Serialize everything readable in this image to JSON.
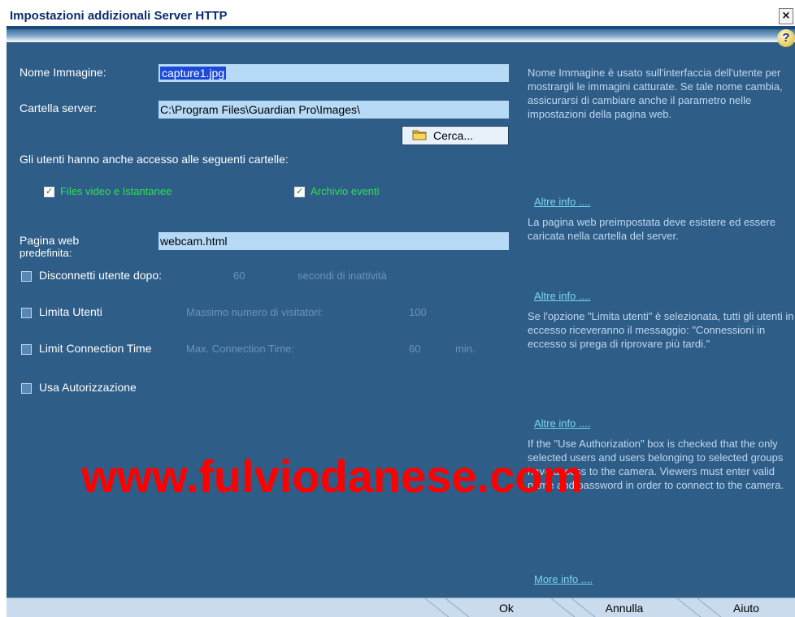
{
  "window": {
    "title": "Impostazioni addizionali Server HTTP",
    "close": "×",
    "help": "?"
  },
  "form": {
    "image_name": {
      "label": "Nome Immagine:",
      "value": "capture1.jpg"
    },
    "server_folder": {
      "label": "Cartella server:",
      "value": "C:\\Program Files\\Guardian Pro\\Images\\"
    },
    "browse_button": "Cerca...",
    "access_label": "Gli utenti hanno anche accesso alle seguenti cartelle:",
    "folder_options": [
      {
        "label": "Files video e Istantanee",
        "checked": true
      },
      {
        "label": "Archivio eventi",
        "checked": true
      }
    ],
    "default_page": {
      "label_line1": "Pagina web",
      "label_line2": "predefinita:",
      "value": "webcam.html"
    },
    "disconnect": {
      "label": "Disconnetti utente dopo:",
      "value": "60",
      "suffix": "secondi di inattività",
      "checked": false
    },
    "limit_users": {
      "label": "Limita Utenti",
      "sublabel": "Massimo numero di visitatori:",
      "value": "100",
      "checked": false
    },
    "limit_time": {
      "label": "Limit Connection Time",
      "sublabel": "Max. Connection Time:",
      "value": "60",
      "suffix": "min.",
      "checked": false
    },
    "use_auth": {
      "label": "Usa Autorizzazione",
      "checked": false
    }
  },
  "help_panel": {
    "p1": "Nome Immagine è usato sull'interfaccia dell'utente per mostrargli le immagini catturate. Se tale nome cambia, assicurarsi di cambiare anche il parametro nelle impostazioni della pagina web.",
    "link1": "Altre info ....",
    "p2": "La pagina web preimpostata deve esistere ed essere caricata nella cartella del server.",
    "link2": "Altre info ....",
    "p3": "Se l'opzione \"Limita utenti\" è selezionata, tutti gli utenti in eccesso riceveranno il messaggio: \"Connessioni in eccesso si prega di riprovare più tardi.\"",
    "link3": "Altre info ....",
    "p4": "If the \"Use Authorization\" box is checked that the only selected users and users belonging to selected groups have access to the camera. Viewers must enter valid name and password in order to connect to the camera.",
    "link4": "More info ...."
  },
  "watermark": "www.fulviodanese.com",
  "footer": {
    "ok": "Ok",
    "cancel": "Annulla",
    "help": "Aiuto"
  },
  "colors": {
    "background": "#2e5d87",
    "field": "#b6daf6",
    "link": "#79d6ef",
    "accent_green": "#2ee053"
  }
}
